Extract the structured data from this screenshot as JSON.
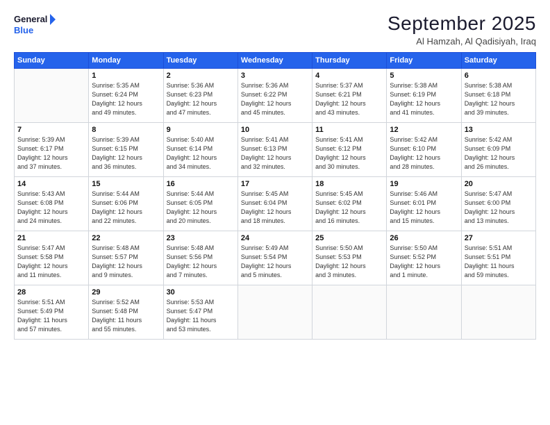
{
  "header": {
    "logo_line1": "General",
    "logo_line2": "Blue",
    "month": "September 2025",
    "location": "Al Hamzah, Al Qadisiyah, Iraq"
  },
  "weekdays": [
    "Sunday",
    "Monday",
    "Tuesday",
    "Wednesday",
    "Thursday",
    "Friday",
    "Saturday"
  ],
  "weeks": [
    [
      {
        "day": "",
        "info": ""
      },
      {
        "day": "1",
        "info": "Sunrise: 5:35 AM\nSunset: 6:24 PM\nDaylight: 12 hours\nand 49 minutes."
      },
      {
        "day": "2",
        "info": "Sunrise: 5:36 AM\nSunset: 6:23 PM\nDaylight: 12 hours\nand 47 minutes."
      },
      {
        "day": "3",
        "info": "Sunrise: 5:36 AM\nSunset: 6:22 PM\nDaylight: 12 hours\nand 45 minutes."
      },
      {
        "day": "4",
        "info": "Sunrise: 5:37 AM\nSunset: 6:21 PM\nDaylight: 12 hours\nand 43 minutes."
      },
      {
        "day": "5",
        "info": "Sunrise: 5:38 AM\nSunset: 6:19 PM\nDaylight: 12 hours\nand 41 minutes."
      },
      {
        "day": "6",
        "info": "Sunrise: 5:38 AM\nSunset: 6:18 PM\nDaylight: 12 hours\nand 39 minutes."
      }
    ],
    [
      {
        "day": "7",
        "info": "Sunrise: 5:39 AM\nSunset: 6:17 PM\nDaylight: 12 hours\nand 37 minutes."
      },
      {
        "day": "8",
        "info": "Sunrise: 5:39 AM\nSunset: 6:15 PM\nDaylight: 12 hours\nand 36 minutes."
      },
      {
        "day": "9",
        "info": "Sunrise: 5:40 AM\nSunset: 6:14 PM\nDaylight: 12 hours\nand 34 minutes."
      },
      {
        "day": "10",
        "info": "Sunrise: 5:41 AM\nSunset: 6:13 PM\nDaylight: 12 hours\nand 32 minutes."
      },
      {
        "day": "11",
        "info": "Sunrise: 5:41 AM\nSunset: 6:12 PM\nDaylight: 12 hours\nand 30 minutes."
      },
      {
        "day": "12",
        "info": "Sunrise: 5:42 AM\nSunset: 6:10 PM\nDaylight: 12 hours\nand 28 minutes."
      },
      {
        "day": "13",
        "info": "Sunrise: 5:42 AM\nSunset: 6:09 PM\nDaylight: 12 hours\nand 26 minutes."
      }
    ],
    [
      {
        "day": "14",
        "info": "Sunrise: 5:43 AM\nSunset: 6:08 PM\nDaylight: 12 hours\nand 24 minutes."
      },
      {
        "day": "15",
        "info": "Sunrise: 5:44 AM\nSunset: 6:06 PM\nDaylight: 12 hours\nand 22 minutes."
      },
      {
        "day": "16",
        "info": "Sunrise: 5:44 AM\nSunset: 6:05 PM\nDaylight: 12 hours\nand 20 minutes."
      },
      {
        "day": "17",
        "info": "Sunrise: 5:45 AM\nSunset: 6:04 PM\nDaylight: 12 hours\nand 18 minutes."
      },
      {
        "day": "18",
        "info": "Sunrise: 5:45 AM\nSunset: 6:02 PM\nDaylight: 12 hours\nand 16 minutes."
      },
      {
        "day": "19",
        "info": "Sunrise: 5:46 AM\nSunset: 6:01 PM\nDaylight: 12 hours\nand 15 minutes."
      },
      {
        "day": "20",
        "info": "Sunrise: 5:47 AM\nSunset: 6:00 PM\nDaylight: 12 hours\nand 13 minutes."
      }
    ],
    [
      {
        "day": "21",
        "info": "Sunrise: 5:47 AM\nSunset: 5:58 PM\nDaylight: 12 hours\nand 11 minutes."
      },
      {
        "day": "22",
        "info": "Sunrise: 5:48 AM\nSunset: 5:57 PM\nDaylight: 12 hours\nand 9 minutes."
      },
      {
        "day": "23",
        "info": "Sunrise: 5:48 AM\nSunset: 5:56 PM\nDaylight: 12 hours\nand 7 minutes."
      },
      {
        "day": "24",
        "info": "Sunrise: 5:49 AM\nSunset: 5:54 PM\nDaylight: 12 hours\nand 5 minutes."
      },
      {
        "day": "25",
        "info": "Sunrise: 5:50 AM\nSunset: 5:53 PM\nDaylight: 12 hours\nand 3 minutes."
      },
      {
        "day": "26",
        "info": "Sunrise: 5:50 AM\nSunset: 5:52 PM\nDaylight: 12 hours\nand 1 minute."
      },
      {
        "day": "27",
        "info": "Sunrise: 5:51 AM\nSunset: 5:51 PM\nDaylight: 11 hours\nand 59 minutes."
      }
    ],
    [
      {
        "day": "28",
        "info": "Sunrise: 5:51 AM\nSunset: 5:49 PM\nDaylight: 11 hours\nand 57 minutes."
      },
      {
        "day": "29",
        "info": "Sunrise: 5:52 AM\nSunset: 5:48 PM\nDaylight: 11 hours\nand 55 minutes."
      },
      {
        "day": "30",
        "info": "Sunrise: 5:53 AM\nSunset: 5:47 PM\nDaylight: 11 hours\nand 53 minutes."
      },
      {
        "day": "",
        "info": ""
      },
      {
        "day": "",
        "info": ""
      },
      {
        "day": "",
        "info": ""
      },
      {
        "day": "",
        "info": ""
      }
    ]
  ]
}
